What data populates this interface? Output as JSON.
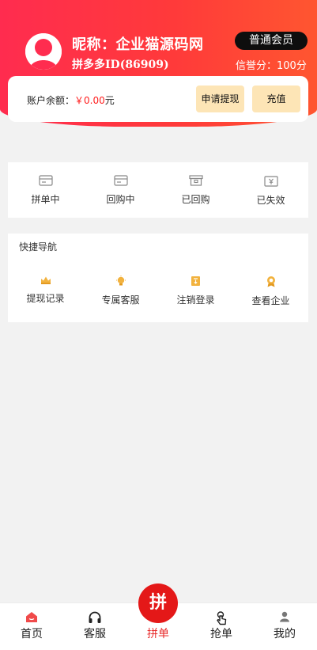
{
  "profile": {
    "nickname": "昵称：企业猫源码网",
    "user_id": "拼多多ID(86909)",
    "member_badge": "普通会员",
    "credit": "信誉分：100分"
  },
  "balance": {
    "label": "账户余额：",
    "amount": "￥0.00",
    "unit": "元",
    "withdraw_button": "申请提现",
    "recharge_button": "充值"
  },
  "order_status": {
    "items": [
      {
        "label": "拼单中",
        "icon": "card-icon"
      },
      {
        "label": "回购中",
        "icon": "card-icon"
      },
      {
        "label": "已回购",
        "icon": "box-icon"
      },
      {
        "label": "已失效",
        "icon": "yen-note-icon"
      }
    ]
  },
  "quick_nav": {
    "title": "快捷导航",
    "items": [
      {
        "label": "提现记录",
        "icon": "crown-icon"
      },
      {
        "label": "专属客服",
        "icon": "bulb-icon"
      },
      {
        "label": "注销登录",
        "icon": "exit-doc-icon"
      },
      {
        "label": "查看企业",
        "icon": "medal-icon"
      }
    ]
  },
  "tabbar": {
    "items": [
      {
        "label": "首页",
        "icon": "home-icon"
      },
      {
        "label": "客服",
        "icon": "headset-icon"
      },
      {
        "label": "拼单",
        "icon": "pin-icon"
      },
      {
        "label": "抢单",
        "icon": "tap-icon"
      },
      {
        "label": "我的",
        "icon": "person-icon"
      }
    ],
    "center_glyph": "拼",
    "active_tab": "拼单"
  },
  "colors": {
    "header_gradient": [
      "#ff2c4f",
      "#ff5630"
    ],
    "accent_red": "#e41818",
    "button_bg": "#fde5b6",
    "icon_gold": "#f2b23e"
  }
}
